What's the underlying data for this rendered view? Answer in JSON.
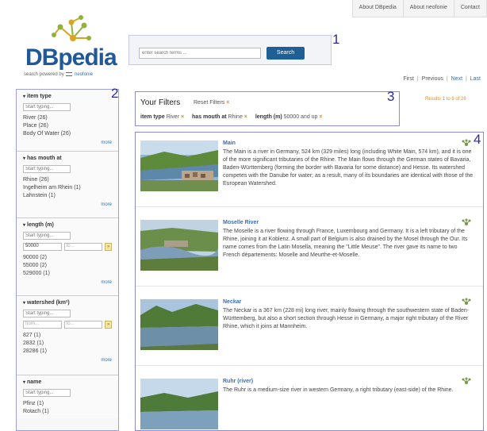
{
  "topnav": {
    "tabs": [
      "About DBpedia",
      "About neofonie",
      "Contact"
    ]
  },
  "logo": {
    "title": "DBpedia",
    "tagline_prefix": "search powered by",
    "tagline_brand": "neofonie"
  },
  "search": {
    "placeholder": "enter search terms ...",
    "button": "Search"
  },
  "markers": [
    "1",
    "2",
    "3",
    "4"
  ],
  "pagination": {
    "first": "First",
    "previous": "Previous",
    "next": "Next",
    "last": "Last",
    "sep": "|"
  },
  "sidebar": {
    "facets": [
      {
        "title": "item type",
        "input_placeholder": "Start typing...",
        "values": [
          "River (26)",
          "Place (26)",
          "Body Of Water (26)"
        ],
        "more": "more"
      },
      {
        "title": "has mouth at",
        "input_placeholder": "Start typing...",
        "values": [
          "Rhine (26)",
          "Ingelheim am Rhein (1)",
          "Lahnstein (1)"
        ],
        "more": "more"
      },
      {
        "title": "length (m)",
        "input_placeholder": "Start typing...",
        "range_from": "50000",
        "range_to": "to...",
        "values": [
          "90000 (2)",
          "55000 (2)",
          "529000 (1)"
        ],
        "more": "more"
      },
      {
        "title": "watershed (km²)",
        "input_placeholder": "Start typing...",
        "range_from": "from...",
        "range_to": "to...",
        "values": [
          "827 (1)",
          "2832 (1)",
          "28286 (1)"
        ],
        "more": "more"
      },
      {
        "title": "name",
        "input_placeholder": "Start typing...",
        "values": [
          "Pfinz (1)",
          "Rotach (1)"
        ],
        "more": "more"
      }
    ]
  },
  "filters": {
    "title": "Your Filters",
    "reset": "Reset Filters",
    "x": "×",
    "items": [
      {
        "key": "item type",
        "value": "River"
      },
      {
        "key": "has mouth at",
        "value": "Rhine"
      },
      {
        "key": "length (m)",
        "value": "50000 and up"
      }
    ]
  },
  "results_count": "Results 1 to 6 of 26",
  "results": [
    {
      "title": "Main",
      "description": "The Main is a river in Germany, 524 km (329 miles) long (including White Main, 574 km), and it is one of the more significant tributaries of the Rhine. The Main flows through the German states of Bavaria, Baden-Württemberg (forming the border with Bavaria for some distance) and Hesse. Its watershed competes with the Danube for water; as a result, many of its boundaries are identical with those of the European Watershed."
    },
    {
      "title": "Moselle River",
      "description": "The Moselle is a river flowing through France, Luxembourg and Germany. It is a left tributary of the Rhine, joining it at Koblenz. A small part of Belgium is also drained by the Mosel through the Our. Its name comes from the Latin Mosella, meaning the \"Little Meuse\". The river gave its name to two French départements: Moselle and Meurthe-et-Moselle."
    },
    {
      "title": "Neckar",
      "description": "The Neckar is a 367 km (228 mi) long river, mainly flowing through the southwestern state of Baden-Württemberg, but also a short section through Hesse in Germany, a major right tributary of the River Rhine, which it joins at Mannheim."
    },
    {
      "title": "Ruhr (river)",
      "description": "The Ruhr is a medium-size river in western Germany, a right tributary (east-side) of the Rhine."
    }
  ],
  "colors": {
    "brand_blue": "#20589a",
    "link_blue": "#3a6fb0",
    "accent_orange": "#e8891a",
    "marker_border": "#8b8bd0"
  }
}
